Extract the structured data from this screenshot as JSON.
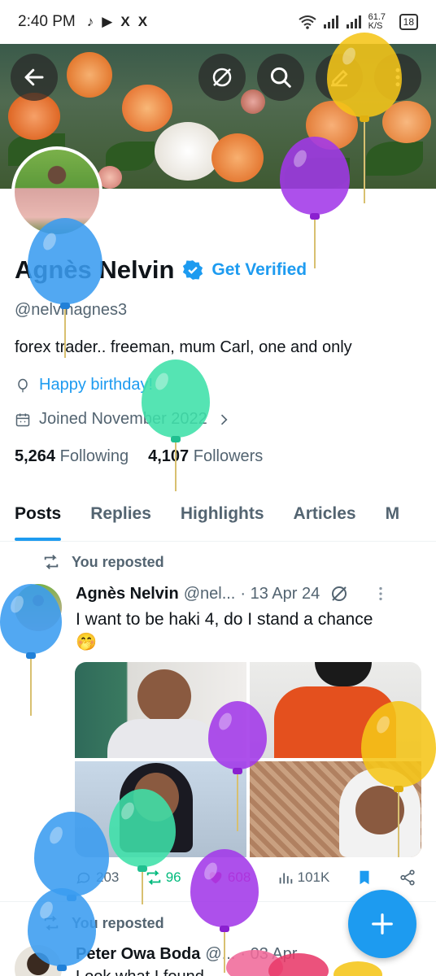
{
  "status_bar": {
    "time": "2:40 PM",
    "apps": [
      "♪",
      "▶",
      "X",
      "X"
    ],
    "speed": "61.7 K/S",
    "battery": "18"
  },
  "profile": {
    "name": "Agnès Nelvin",
    "get_verified": "Get Verified",
    "handle": "@nelvinagnes3",
    "bio": "forex trader..  freeman, mum Carl, one and only",
    "birthday": "Happy birthday!",
    "joined": "Joined November 2022",
    "following_count": "5,264",
    "following_label": "Following",
    "followers_count": "4,107",
    "followers_label": "Followers"
  },
  "tabs": [
    "Posts",
    "Replies",
    "Highlights",
    "Articles",
    "M"
  ],
  "posts": [
    {
      "repost_label": "You reposted",
      "author": "Agnès Nelvin",
      "handle": "@nel...",
      "date": "· 13 Apr 24",
      "text": "I want to be haki 4, do I stand a chance",
      "emoji": "🤭",
      "replies": "203",
      "reposts": "96",
      "likes": "608",
      "views": "101K"
    },
    {
      "repost_label": "You reposted",
      "author": "Peter Owa Boda",
      "handle": "@...",
      "date": "· 03 Apr",
      "text": "Look what I found"
    }
  ],
  "colors": {
    "accent": "#1d9bf0",
    "repost_green": "#00ba7c",
    "like_pink": "#f91880",
    "text": "#0f1419",
    "muted": "#536471"
  },
  "icons": [
    "back-arrow-icon",
    "circle-slash-icon",
    "search-icon",
    "edit-icon",
    "more-vertical-icon",
    "verified-badge-icon",
    "balloon-icon",
    "calendar-icon",
    "chevron-right-icon",
    "repost-icon",
    "reply-icon",
    "like-icon",
    "views-icon",
    "bookmark-icon",
    "share-icon",
    "plus-icon"
  ]
}
